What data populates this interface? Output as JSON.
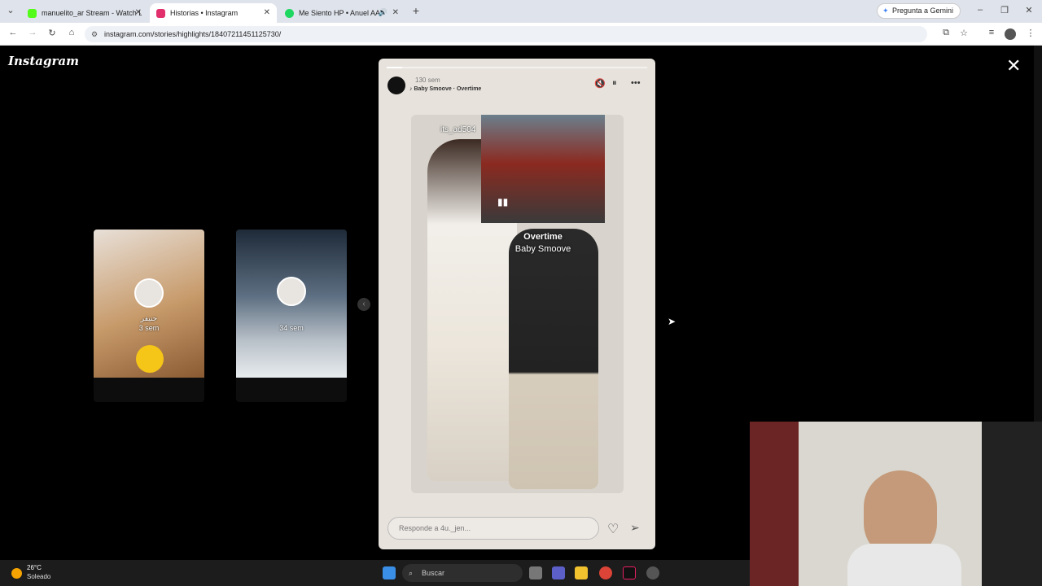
{
  "browser": {
    "tabs": [
      {
        "label": "manuelito_ar Stream - Watch L",
        "color": "#53fc18"
      },
      {
        "label": "Historias • Instagram",
        "color": "#e1306c"
      },
      {
        "label": "Me Siento HP • Anuel AA",
        "color": "#1ed760"
      }
    ],
    "url": "instagram.com/stories/highlights/18407211451125730/",
    "gemini_label": "Pregunta a Gemini"
  },
  "instagram": {
    "logo": "Instagram",
    "previews": [
      {
        "name": "جنيفر",
        "time": "3 sem"
      },
      {
        "name": "",
        "time": "34 sem"
      }
    ],
    "story": {
      "time": "130 sem",
      "music": "Baby Smoove · Overtime",
      "username": "its_ad504",
      "song_title": "Overtime",
      "song_artist": "Baby Smoove",
      "reply_placeholder": "Responde a 4u._jen...",
      "progress": 0.06
    }
  },
  "taskbar": {
    "temperature": "26°C",
    "condition": "Soleado",
    "search_label": "Buscar"
  }
}
